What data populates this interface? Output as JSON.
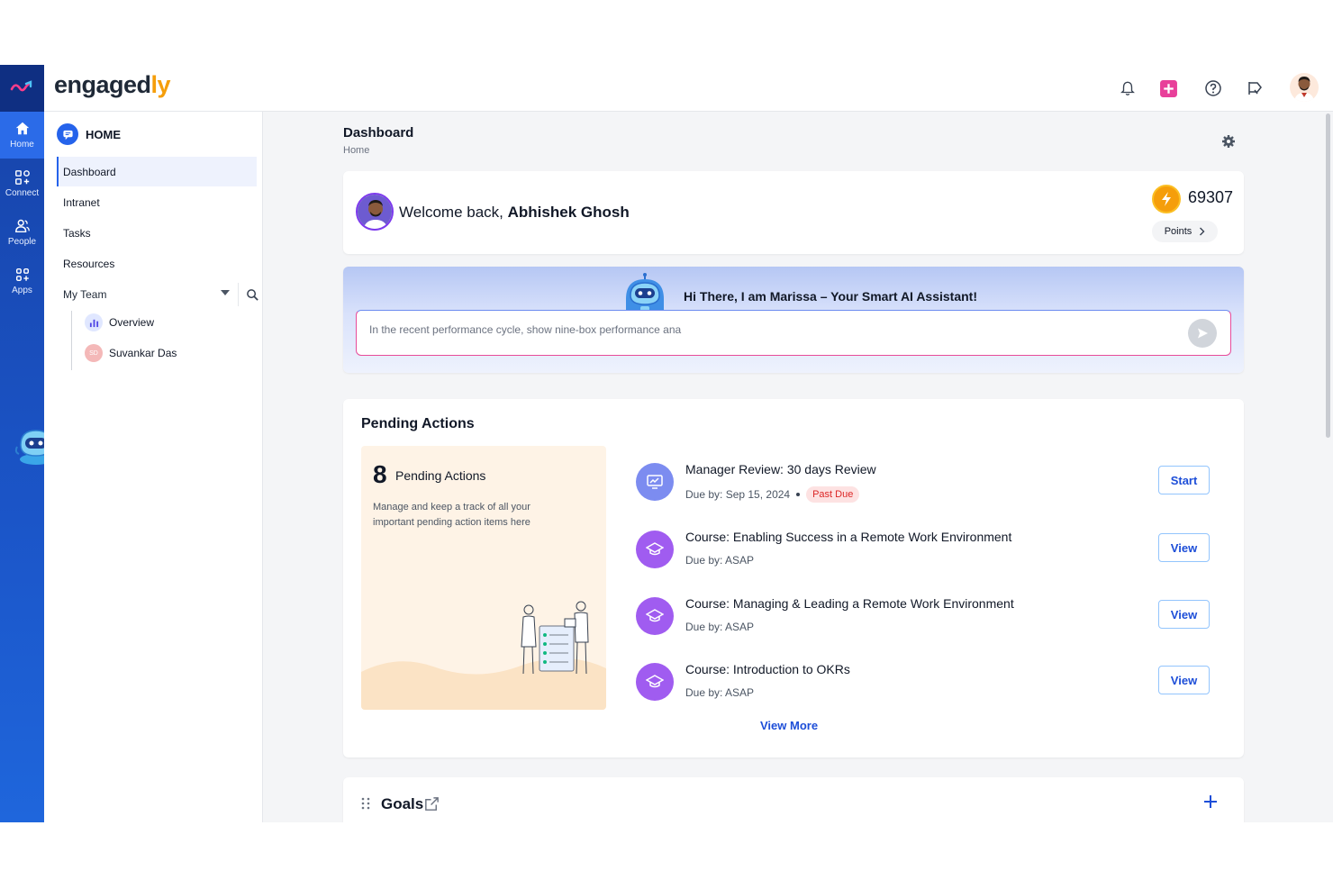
{
  "header": {
    "brand_main": "engaged",
    "brand_accent": "ly"
  },
  "rail": {
    "items": [
      {
        "label": "Home",
        "icon": "home-icon"
      },
      {
        "label": "Connect",
        "icon": "connect-icon"
      },
      {
        "label": "People",
        "icon": "people-icon"
      },
      {
        "label": "Apps",
        "icon": "apps-icon"
      }
    ]
  },
  "sidebar": {
    "section_title": "HOME",
    "items": [
      {
        "label": "Dashboard",
        "active": true
      },
      {
        "label": "Intranet"
      },
      {
        "label": "Tasks"
      },
      {
        "label": "Resources"
      }
    ],
    "team": {
      "label": "My Team",
      "children": [
        {
          "label": "Overview"
        },
        {
          "label": "Suvankar Das",
          "initials": "SD"
        }
      ]
    }
  },
  "page": {
    "title": "Dashboard",
    "breadcrumb": "Home"
  },
  "welcome": {
    "greeting": "Welcome back,",
    "name": "Abhishek Ghosh",
    "points_value": "69307",
    "points_label": "Points"
  },
  "assistant": {
    "title": "Hi There, I am Marissa – Your Smart AI Assistant!",
    "input_value": "In the recent performance cycle, show nine-box performance ana"
  },
  "pending": {
    "title": "Pending Actions",
    "count": "8",
    "count_label": "Pending Actions",
    "description": "Manage and keep a track of all your important pending action items here",
    "actions": [
      {
        "title": "Manager Review: 30 days Review",
        "due": "Due by: Sep 15, 2024",
        "badge": "Past Due",
        "button": "Start",
        "icon_color": "#7c8cf0"
      },
      {
        "title": "Course: Enabling Success in a Remote Work Environment",
        "due": "Due by: ASAP",
        "button": "View",
        "icon_color": "#a05cf0"
      },
      {
        "title": "Course: Managing & Leading a Remote Work Environment",
        "due": "Due by: ASAP",
        "button": "View",
        "icon_color": "#a05cf0"
      },
      {
        "title": "Course: Introduction to OKRs",
        "due": "Due by: ASAP",
        "button": "View",
        "icon_color": "#a05cf0"
      }
    ],
    "view_more": "View More"
  },
  "goals": {
    "title": "Goals"
  },
  "colors": {
    "primary": "#2563eb",
    "accent": "#f59e0b",
    "past_due": "#dc2626"
  }
}
